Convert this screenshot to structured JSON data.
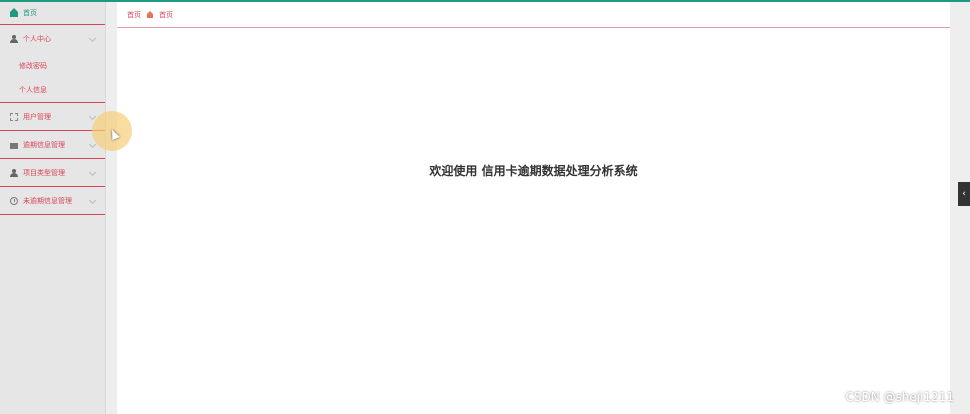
{
  "sidebar": {
    "home": "首页",
    "personal_center": "个人中心",
    "change_password": "修改密码",
    "personal_info": "个人信息",
    "user_management": "用户管理",
    "overdue_info_management": "逾期信息管理",
    "project_type_management": "项目类型管理",
    "non_overdue_info_management": "未逾期信息管理"
  },
  "breadcrumb": {
    "root": "首页",
    "current": "首页"
  },
  "main": {
    "welcome_text": "欢迎使用 信用卡逾期数据处理分析系统"
  },
  "toggle_glyph": "‹",
  "watermark": "CSDN @sheji1211",
  "colors": {
    "accent": "#1f9a82",
    "menu_text": "#d94455",
    "breadcrumb_icon": "#e8735a"
  }
}
